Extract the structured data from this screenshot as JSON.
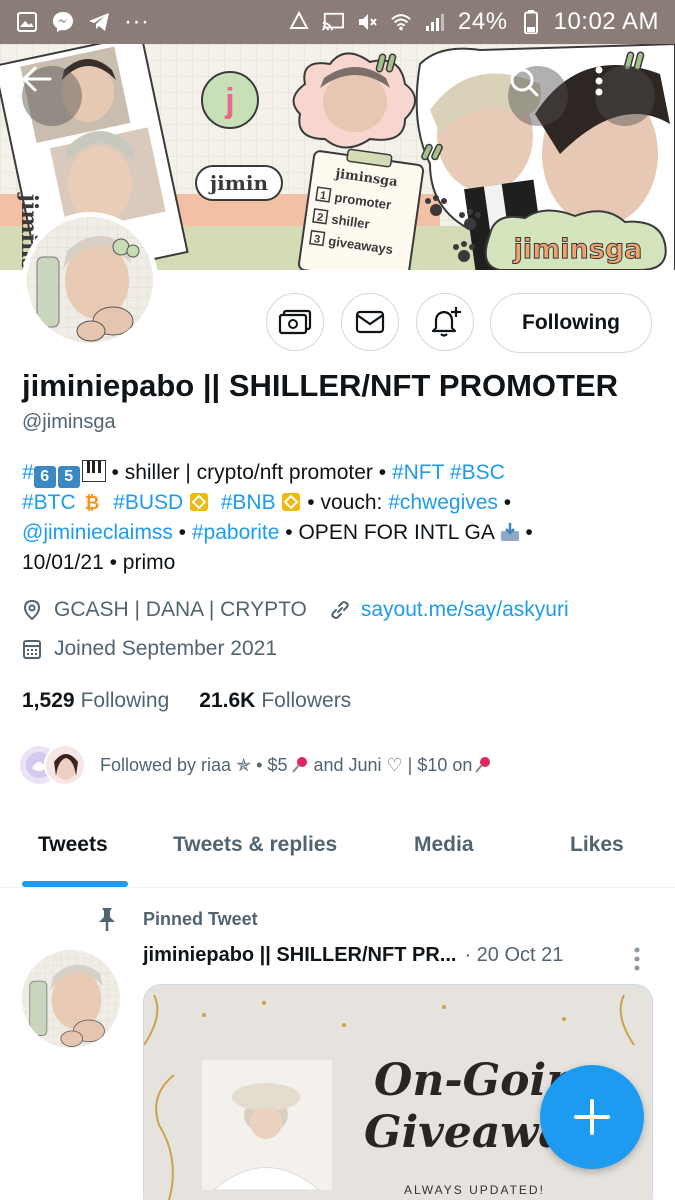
{
  "statusbar": {
    "battery": "24%",
    "time": "10:02 AM",
    "dots": "···"
  },
  "banner": {
    "brand_text": "jiminsga",
    "sticker_name": "jimin",
    "side_text": "jiminsga",
    "clipboard_title": "jiminsga",
    "clipboard_items": [
      {
        "num": "1",
        "text": "promoter"
      },
      {
        "num": "2",
        "text": "shiller"
      },
      {
        "num": "3",
        "text": "giveaways"
      }
    ],
    "circle_letter": "j"
  },
  "profile": {
    "display_name": "jiminiepabo || SHILLER/NFT PROMOTER",
    "handle": "@jiminsga",
    "follow_button": "Following",
    "bio": {
      "line1_num1": "6",
      "line1_num2": "5",
      "line1_text": " • shiller | crypto/nft promoter • ",
      "tag_nft": "#NFT",
      "tag_bsc": "#BSC",
      "tag_btc": "#BTC",
      "tag_busd": "#BUSD",
      "tag_bnb": "#BNB",
      "vouch_text": " • vouch: ",
      "tag_chwegives": "#chwegives",
      "bullet": " •",
      "mention": "@jiminieclaimss",
      "sep": " • ",
      "tag_paborite": "#paborite",
      "open_text": " • OPEN FOR INTL GA ",
      "bullet2": " •",
      "date_text": "10/01/21 • primo"
    },
    "location": "GCASH | DANA | CRYPTO",
    "url": "sayout.me/say/askyuri",
    "joined": "Joined September 2021",
    "following_count": "1,529",
    "following_label": "Following",
    "followers_count": "21.6K",
    "followers_label": "Followers",
    "followed_by": "Followed by riaa ✯ • $5 ",
    "followed_by_2": " and Juni ♡ | $10 on "
  },
  "tabs": [
    {
      "label": "Tweets",
      "active": true
    },
    {
      "label": "Tweets & replies",
      "active": false
    },
    {
      "label": "Media",
      "active": false
    },
    {
      "label": "Likes",
      "active": false
    }
  ],
  "tweet": {
    "pinned_label": "Pinned Tweet",
    "author": "jiminiepabo || SHILLER/NFT PR...",
    "date": "· 20 Oct 21",
    "card_title_1": "On-Goin",
    "card_title_2": "Giveaways",
    "card_subtitle": "ALWAYS UPDATED!"
  },
  "colors": {
    "accent": "#1d9bf0",
    "statusbar": "#8a7d78",
    "text_primary": "#0f1419",
    "text_secondary": "#536471"
  }
}
